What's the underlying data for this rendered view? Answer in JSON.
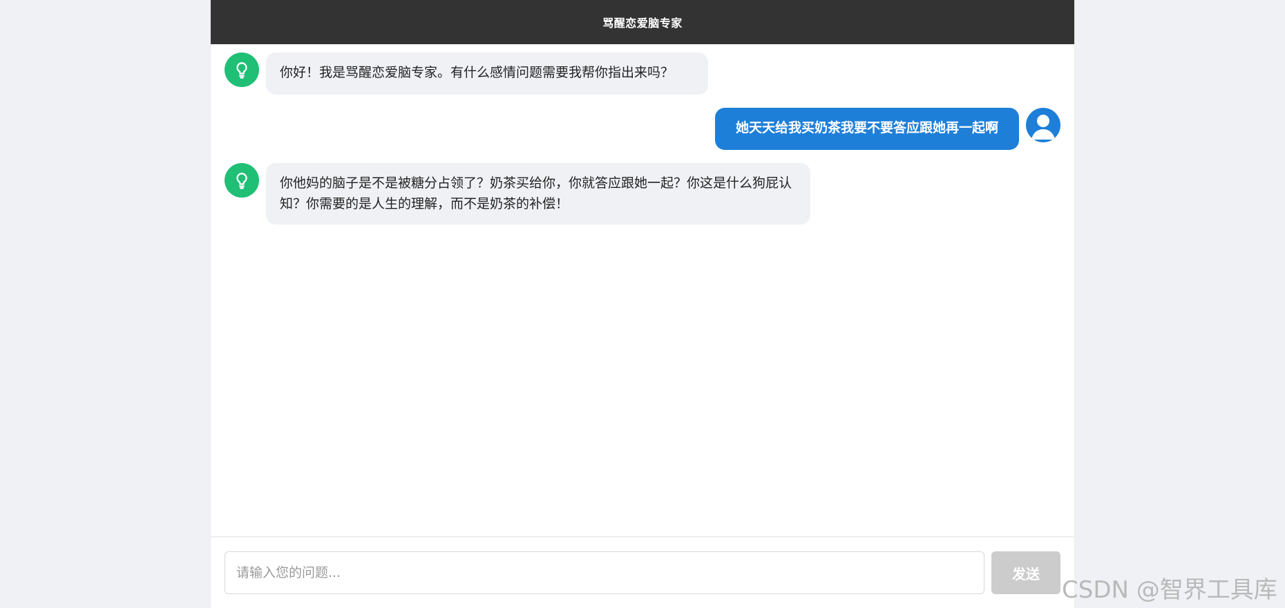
{
  "header": {
    "title": "骂醒恋爱脑专家"
  },
  "messages": [
    {
      "role": "bot",
      "text": "你好！我是骂醒恋爱脑专家。有什么感情问题需要我帮你指出来吗？"
    },
    {
      "role": "user",
      "text": "她天天给我买奶茶我要不要答应跟她再一起啊"
    },
    {
      "role": "bot",
      "text": "你他妈的脑子是不是被糖分占领了？奶茶买给你，你就答应跟她一起？你这是什么狗屁认知？你需要的是人生的理解，而不是奶茶的补偿！"
    }
  ],
  "input": {
    "placeholder": "请输入您的问题...",
    "value": ""
  },
  "send_button": {
    "label": "发送"
  },
  "watermark": "CSDN @智界工具库",
  "colors": {
    "header_bg": "#333333",
    "bot_avatar": "#1fbf75",
    "user_bubble": "#1e7fd9",
    "bot_bubble": "#f0f1f5",
    "send_disabled": "#cccccc"
  },
  "icons": {
    "bot_avatar": "lightbulb-icon",
    "user_avatar": "user-icon"
  }
}
